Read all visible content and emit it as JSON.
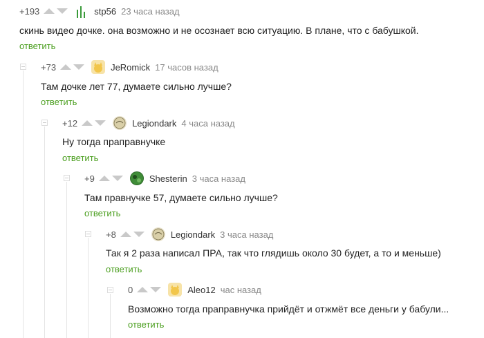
{
  "comments": [
    {
      "rating": "+193",
      "author": "stp56",
      "time": "23 часа назад",
      "text": "скинь видео дочке. она возможно и не осознает всю ситуацию. В плане, что с бабушкой.",
      "reply": "ответить",
      "avatar": "bars-icon"
    },
    {
      "rating": "+73",
      "author": "JeRomick",
      "time": "17 часов назад",
      "text": "Там дочке лет 77, думаете сильно лучше?",
      "reply": "ответить",
      "avatar": "cat-avatar"
    },
    {
      "rating": "+12",
      "author": "Legiondark",
      "time": "4 часа назад",
      "text": "Ну тогда праправнучке",
      "reply": "ответить",
      "avatar": "sketch-avatar"
    },
    {
      "rating": "+9",
      "author": "Shesterin",
      "time": "3 часа назад",
      "text": "Там правнучке 57, думаете сильно лучше?",
      "reply": "ответить",
      "avatar": "green-avatar"
    },
    {
      "rating": "+8",
      "author": "Legiondark",
      "time": "3 часа назад",
      "text": "Так я 2 раза написал ПРА, так что глядишь около 30 будет, а то и меньше)",
      "reply": "ответить",
      "avatar": "sketch-avatar"
    },
    {
      "rating": "0",
      "author": "Aleo12",
      "time": "час назад",
      "text": "Возможно тогда праправнучка прийдёт и отжмёт все деньги у бабули...",
      "reply": "ответить",
      "avatar": "cat-avatar"
    }
  ],
  "colors": {
    "reply": "#4a9e1e",
    "arrow": "#c9c9c9",
    "thread_line": "#e4e4e4"
  }
}
